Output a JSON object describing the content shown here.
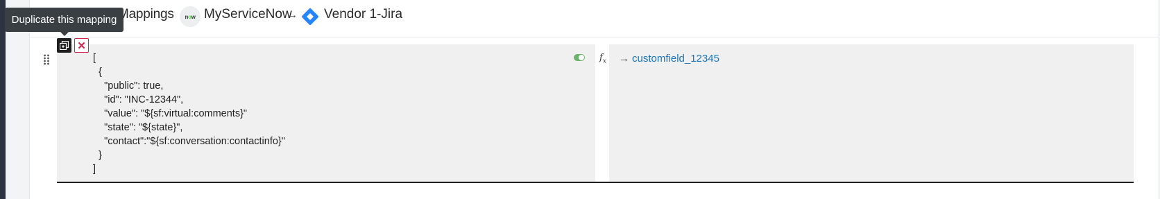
{
  "header": {
    "title": "Outbound Mappings",
    "source": "MyServiceNow",
    "separator": "→",
    "target": "Vendor 1-Jira",
    "source_logo_text": "now"
  },
  "tooltip": {
    "text": "Duplicate this mapping"
  },
  "mapping": {
    "duplicate_icon": "duplicate-icon",
    "delete_icon": "close-icon",
    "delete_symbol": "✕",
    "source_code": "[\n  {\n    \"public\": true,\n    \"id\": \"INC-12344\",\n    \"value\": \"${sf:virtual:comments}\"\n    \"state\": \"${state}\",\n    \"contact\":\"${sf:conversation:contactinfo}\"\n  }\n]",
    "enabled": true,
    "fx_label": "f",
    "fx_sub": "x",
    "target_arrow": "→",
    "target_field": "customfield_12345"
  },
  "colors": {
    "accent_link": "#1c73b8",
    "toggle_on": "#6bb36b",
    "delete_red": "#d1234a",
    "tooltip_bg": "#3a3f44"
  }
}
